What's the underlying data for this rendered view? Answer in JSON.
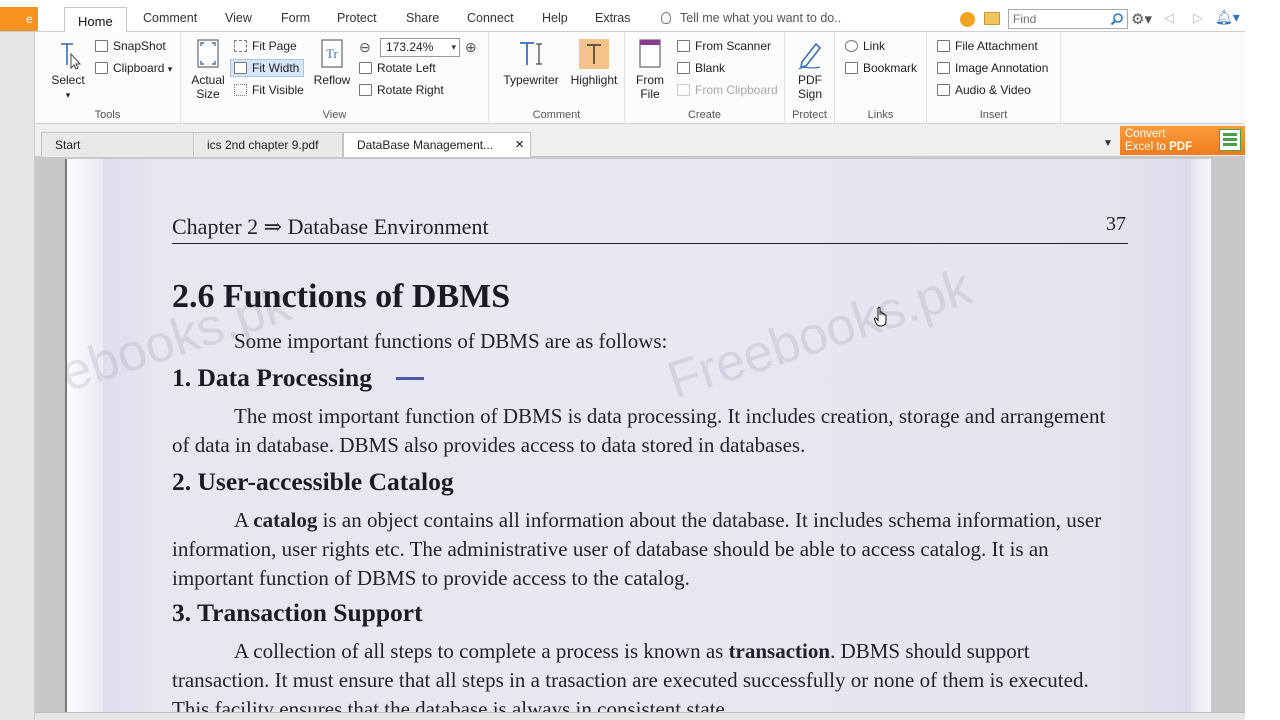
{
  "menu": {
    "file_partial": "e",
    "items": [
      "Home",
      "Comment",
      "View",
      "Form",
      "Protect",
      "Share",
      "Connect",
      "Help",
      "Extras"
    ],
    "active": "Home",
    "tell_me": "Tell me what you want to do..",
    "find_placeholder": "Find"
  },
  "ribbon": {
    "tools": {
      "label": "Tools",
      "select": "Select",
      "snapshot": "SnapShot",
      "clipboard": "Clipboard"
    },
    "view": {
      "label": "View",
      "actual_size_1": "Actual",
      "actual_size_2": "Size",
      "fit_page": "Fit Page",
      "fit_width": "Fit Width",
      "fit_visible": "Fit Visible",
      "reflow": "Reflow",
      "zoom": "173.24%",
      "rotate_left": "Rotate Left",
      "rotate_right": "Rotate Right"
    },
    "comment": {
      "label": "Comment",
      "typewriter": "Typewriter",
      "highlight": "Highlight"
    },
    "create": {
      "label": "Create",
      "from_file_1": "From",
      "from_file_2": "File",
      "from_scanner": "From Scanner",
      "blank": "Blank",
      "from_clipboard": "From Clipboard"
    },
    "protect": {
      "label": "Protect",
      "pdf_sign_1": "PDF",
      "pdf_sign_2": "Sign"
    },
    "links": {
      "label": "Links",
      "link": "Link",
      "bookmark": "Bookmark"
    },
    "insert": {
      "label": "Insert",
      "file_attachment": "File Attachment",
      "image_annotation": "Image Annotation",
      "audio_video": "Audio & Video"
    }
  },
  "tabs": {
    "items": [
      "Start",
      "ics 2nd chapter 9.pdf",
      "DataBase Management..."
    ],
    "active": "DataBase Management..."
  },
  "banner": {
    "line1": "Convert",
    "line2_a": "Excel to ",
    "line2_b": "PDF",
    "badge": "XLS"
  },
  "colors": {
    "accent_orange": "#f7931e",
    "selected_blue": "#d6e6f7",
    "page_tint": "#e9e7f3"
  },
  "document": {
    "running_head": "Chapter 2 ⇒ Database Environment",
    "page_number": "37",
    "section_title": "2.6 Functions of DBMS",
    "intro": "Some important functions of DBMS are as follows:",
    "h1": "1. Data Processing",
    "p1": "The most important function of DBMS is data processing. It includes creation, storage and arrangement of data in database. DBMS also provides access to data stored in databases.",
    "h2": "2. User-accessible Catalog",
    "p2_a": "A ",
    "p2_bold": "catalog",
    "p2_b": " is an object contains all information about the database. It includes schema information, user information, user rights etc. The administrative user of database should be able to access catalog. It is an important function of DBMS to provide access to the catalog.",
    "h3": "3. Transaction Support",
    "p3_a": "A collection of all steps to complete a process is known as ",
    "p3_bold": "transaction",
    "p3_b": ". DBMS should support transaction. It must ensure that all steps in a trasaction are executed successfully or none of them is executed. This facility ensures that the database is always in consistent state",
    "watermark_1": "ebooks.pk",
    "watermark_2": "Freebooks.pk"
  }
}
